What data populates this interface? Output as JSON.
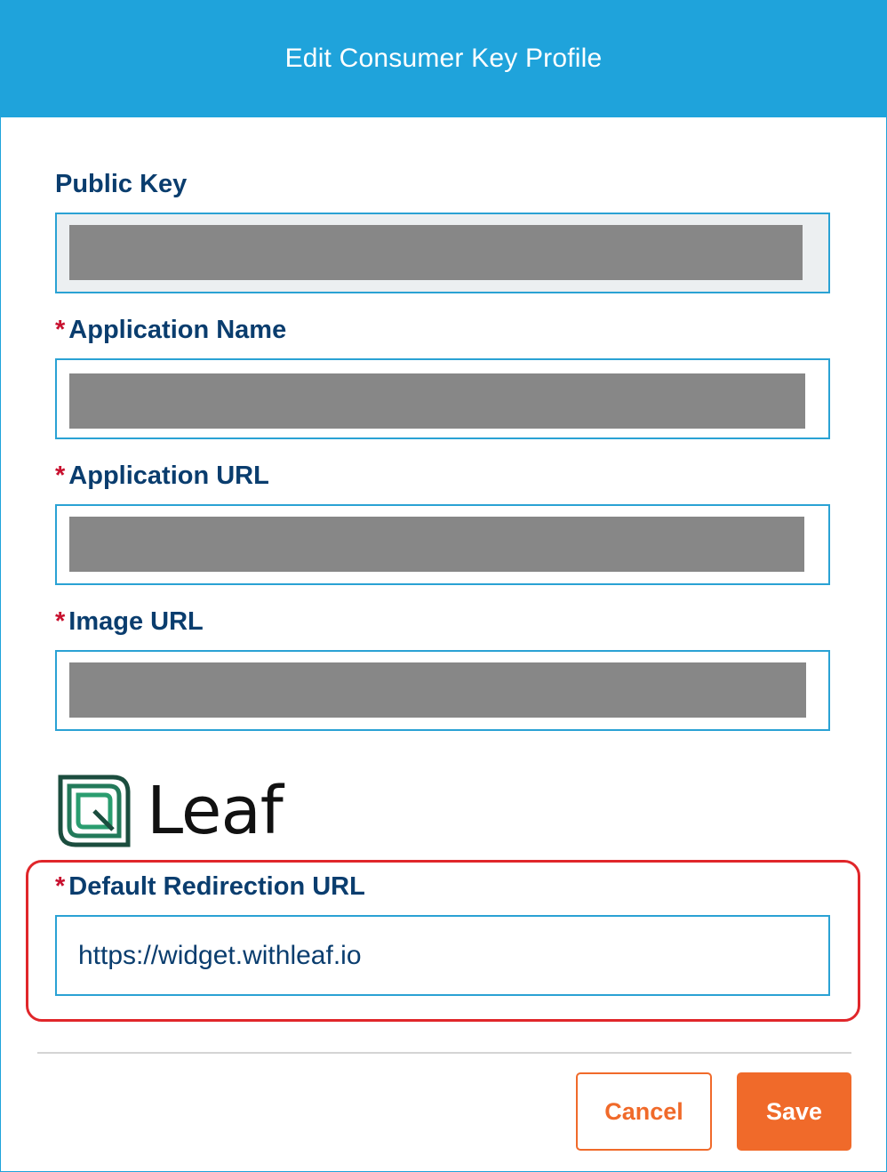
{
  "dialog": {
    "title": "Edit Consumer Key Profile"
  },
  "form": {
    "public_key": {
      "label": "Public Key",
      "value": ""
    },
    "application_name": {
      "label": "Application Name",
      "required_marker": "*",
      "value": ""
    },
    "application_url": {
      "label": "Application URL",
      "required_marker": "*",
      "value": ""
    },
    "image_url": {
      "label": "Image URL",
      "required_marker": "*",
      "value": ""
    },
    "logo": {
      "word": "Leaf",
      "icon": "leaf-logo-icon"
    },
    "default_redirection_url": {
      "label": "Default Redirection URL",
      "required_marker": "*",
      "value": "https://widget.withleaf.io"
    }
  },
  "actions": {
    "cancel_label": "Cancel",
    "save_label": "Save"
  },
  "colors": {
    "header": "#1fa3db",
    "label": "#0a3d6e",
    "required": "#c8102e",
    "field_border": "#2aa2d4",
    "highlight": "#e0262a",
    "accent": "#f06a2a",
    "logo_green_dark": "#1b4d3e",
    "logo_green_light": "#2a9d6f"
  }
}
